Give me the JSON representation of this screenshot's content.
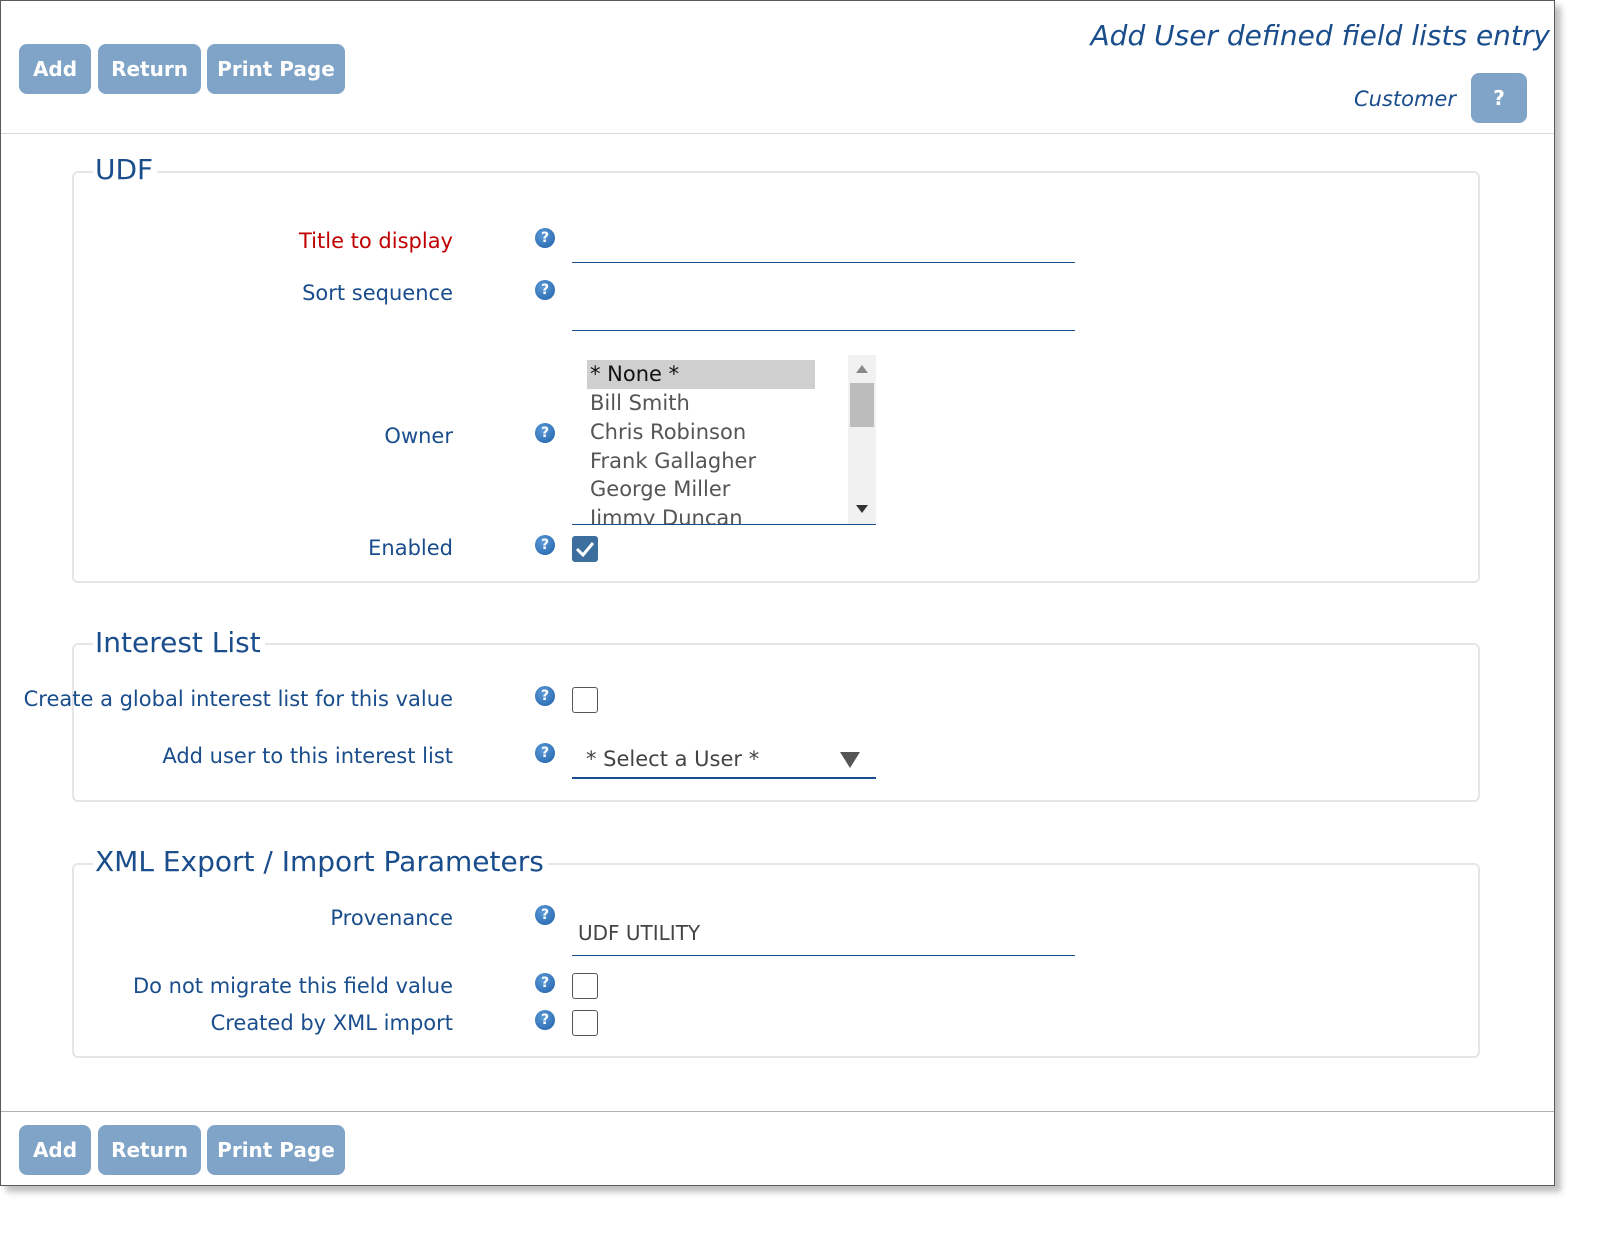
{
  "toolbar": {
    "add_label": "Add",
    "return_label": "Return",
    "print_label": "Print Page"
  },
  "header": {
    "title": "Add User defined field lists entry",
    "subject": "Customer",
    "help_label": "?"
  },
  "udf": {
    "legend": "UDF",
    "title_label": "Title to display",
    "title_value": "",
    "sort_label": "Sort sequence",
    "sort_value": "",
    "owner_label": "Owner",
    "owner_options": [
      "* None *",
      "Bill Smith",
      "Chris Robinson",
      "Frank Gallagher",
      "George Miller",
      "Jimmy Duncan"
    ],
    "owner_selected": "* None *",
    "enabled_label": "Enabled",
    "enabled": true
  },
  "interest": {
    "legend": "Interest List",
    "global_label": "Create a global interest list for this value",
    "global_checked": false,
    "add_user_label": "Add user to this interest list",
    "add_user_value": "* Select a User *"
  },
  "xml": {
    "legend": "XML Export / Import Parameters",
    "provenance_label": "Provenance",
    "provenance_value": "UDF UTILITY",
    "no_migrate_label": "Do not migrate this field value",
    "no_migrate_checked": false,
    "created_label": "Created by XML import",
    "created_checked": false
  },
  "colors": {
    "label": "#1a4d8c",
    "required": "#c00000",
    "button": "#7fa4c7",
    "checkbox_on": "#3d6f9e"
  },
  "icons": [
    "question-icon",
    "checkmark-icon",
    "dropdown-arrow-icon",
    "scroll-up-icon",
    "scroll-down-icon"
  ]
}
